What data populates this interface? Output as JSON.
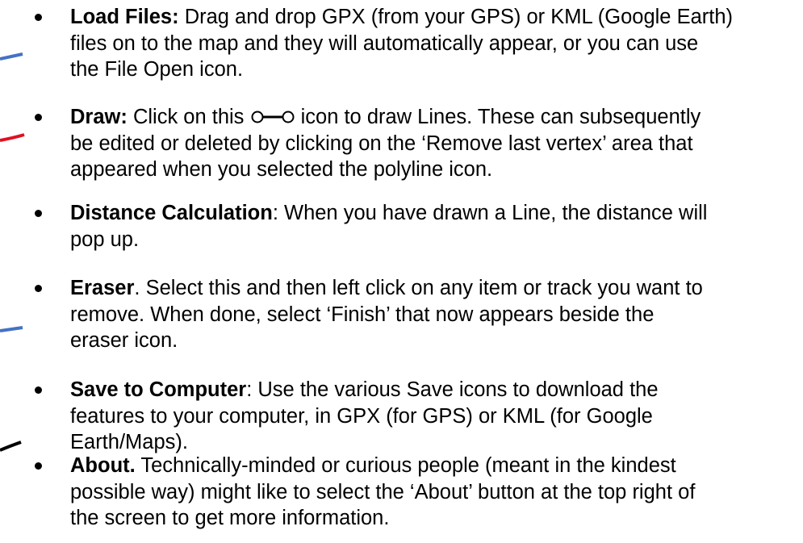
{
  "items": [
    {
      "title": "Load Files:",
      "lines": [
        "Drag and drop GPX (from your GPS) or KML (Google Earth)",
        "files on to the map and they will automatically appear, or you can use",
        "the File Open icon."
      ]
    },
    {
      "title": "Draw:",
      "line1_before": "Click on this",
      "line1_after": "icon to draw Lines. These can subsequently",
      "lines": [
        "be edited or deleted by clicking on the ‘Remove last vertex’ area that",
        "appeared when you selected the polyline icon."
      ]
    },
    {
      "title": "Distance Calculation",
      "lines": [
        ": When you have drawn a Line, the distance will",
        "pop up."
      ]
    },
    {
      "title": "Eraser",
      "lines": [
        ".  Select this and then left click on any item or track you want to",
        "remove.  When done, select ‘Finish’ that now appears beside the",
        "eraser icon."
      ]
    },
    {
      "title": "Save to Computer",
      "lines": [
        ": Use the various Save icons to download the",
        "features to your computer, in GPX (for GPS) or KML (for Google",
        "Earth/Maps)."
      ]
    },
    {
      "title": "About.",
      "lines": [
        " Technically-minded or curious people (meant in the kindest",
        "possible way) might like to select the ‘About’ button at the top right of",
        "the screen to get more information."
      ]
    }
  ],
  "colors": {
    "blue": "#4472c4",
    "red": "#e01020",
    "black": "#000000"
  },
  "icons": [
    "polyline-icon"
  ]
}
